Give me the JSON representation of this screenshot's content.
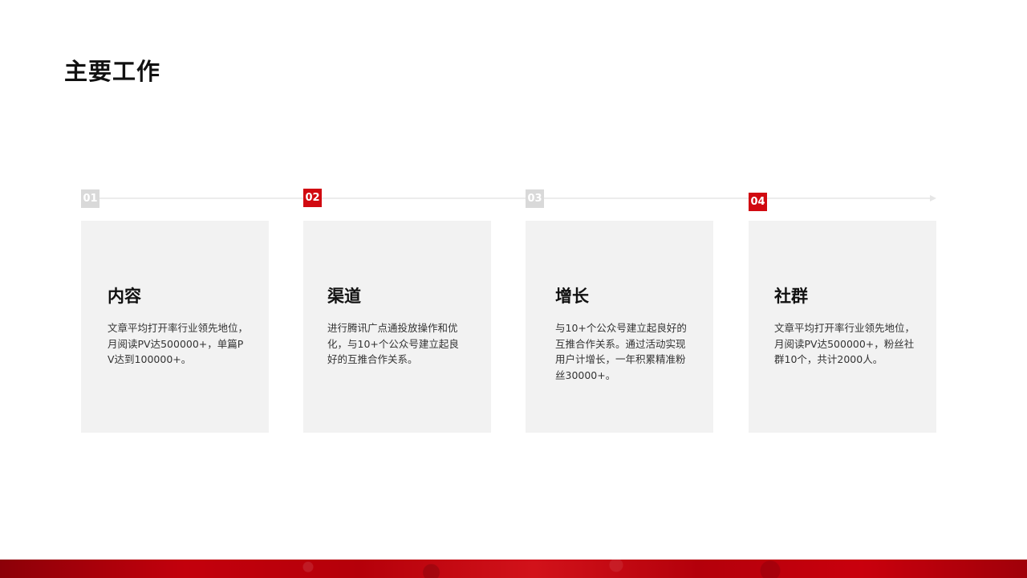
{
  "slide": {
    "title": "主要工作"
  },
  "steps": [
    {
      "number": "01",
      "title": "内容",
      "text": "文章平均打开率行业领先地位，月阅读PV达500000+，单篇PV达到100000+。"
    },
    {
      "number": "02",
      "title": "渠道",
      "text": "进行腾讯广点通投放操作和优化，与10+个公众号建立起良好的互推合作关系。"
    },
    {
      "number": "03",
      "title": "增长",
      "text": "与10+个公众号建立起良好的互推合作关系。通过活动实现用户计增长，一年积累精准粉丝30000+。"
    },
    {
      "number": "04",
      "title": "社群",
      "text": "文章平均打开率行业领先地位，月阅读PV达500000+，粉丝社群10个，共计2000人。"
    }
  ],
  "colors": {
    "accent": "#d10a11",
    "inactive_badge": "#d9d9d9",
    "card_background": "#f2f2f2"
  }
}
